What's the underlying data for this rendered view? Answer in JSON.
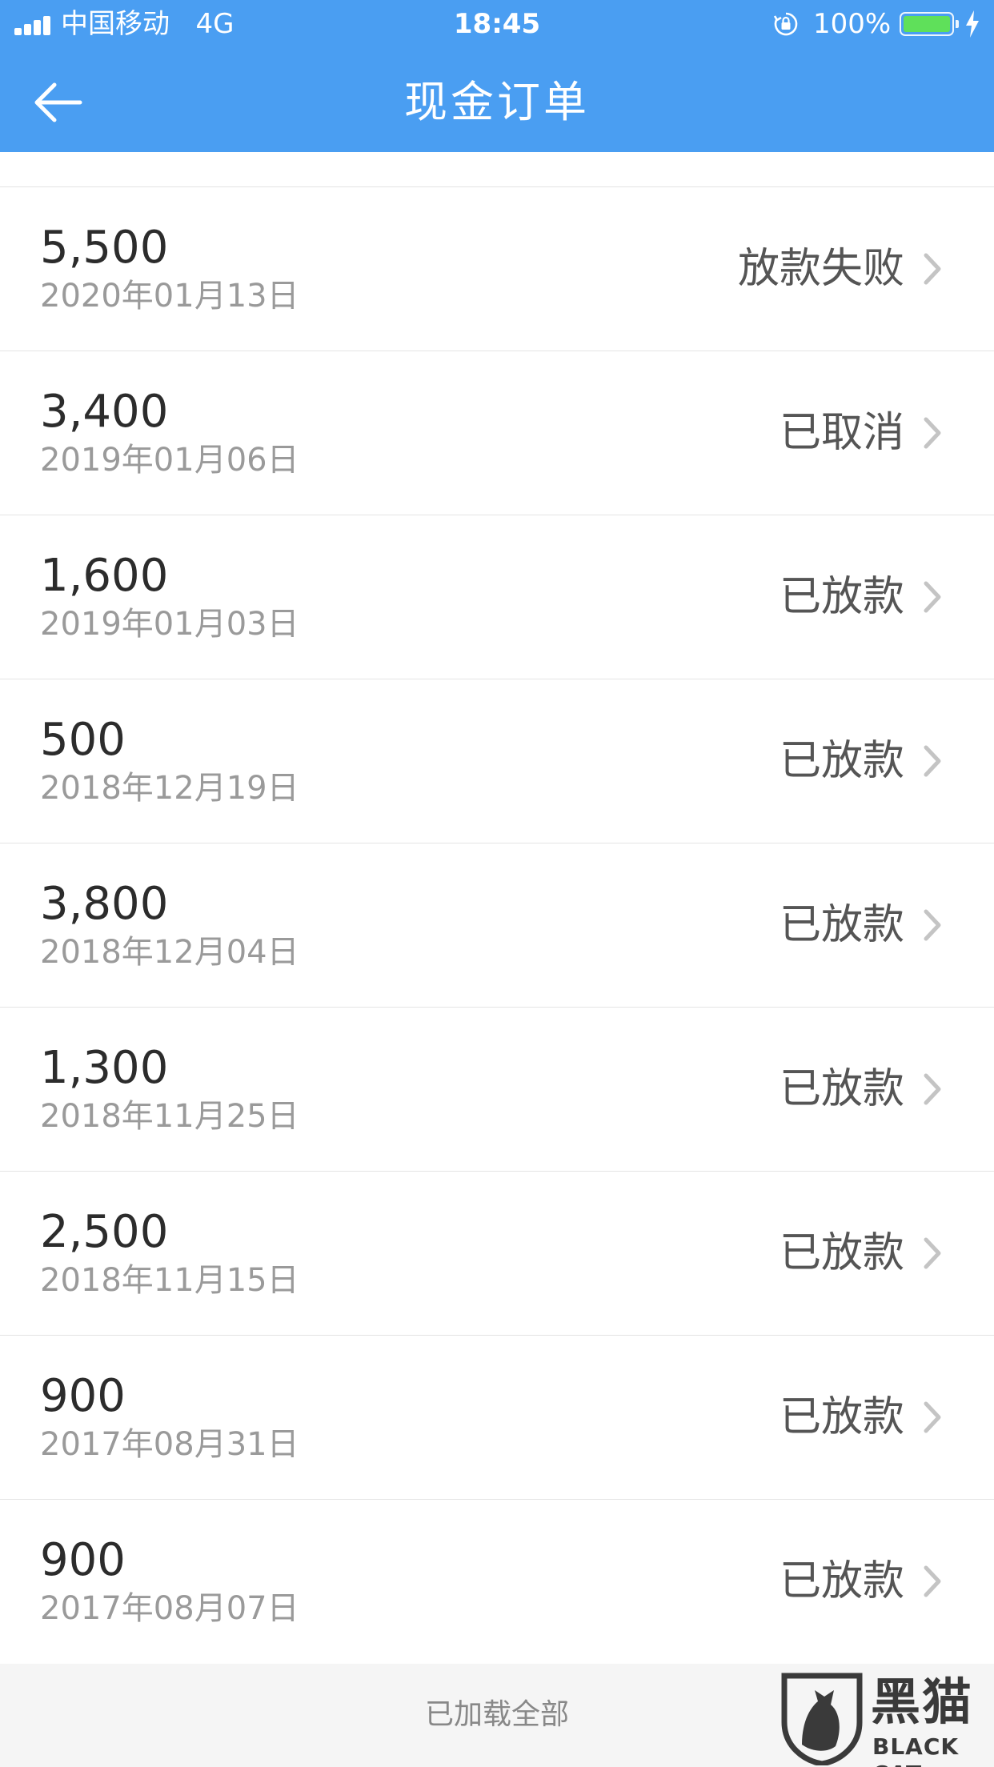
{
  "status_bar": {
    "carrier": "中国移动",
    "network": "4G",
    "time": "18:45",
    "battery": "100%",
    "battery_level": 1.0,
    "battery_color": "#5fe05a"
  },
  "nav": {
    "title": "现金订单",
    "back_icon": "arrow-left-icon",
    "background": "#4a9ef2"
  },
  "orders": [
    {
      "amount": "5,500",
      "date": "2020年01月13日",
      "status": "放款失败"
    },
    {
      "amount": "3,400",
      "date": "2019年01月06日",
      "status": "已取消"
    },
    {
      "amount": "1,600",
      "date": "2019年01月03日",
      "status": "已放款"
    },
    {
      "amount": "500",
      "date": "2018年12月19日",
      "status": "已放款"
    },
    {
      "amount": "3,800",
      "date": "2018年12月04日",
      "status": "已放款"
    },
    {
      "amount": "1,300",
      "date": "2018年11月25日",
      "status": "已放款"
    },
    {
      "amount": "2,500",
      "date": "2018年11月15日",
      "status": "已放款"
    },
    {
      "amount": "900",
      "date": "2017年08月31日",
      "status": "已放款"
    },
    {
      "amount": "900",
      "date": "2017年08月07日",
      "status": "已放款"
    }
  ],
  "footer": {
    "text": "已加载全部"
  },
  "watermark": {
    "cn": "黑猫",
    "en": "BLACK CAT"
  }
}
